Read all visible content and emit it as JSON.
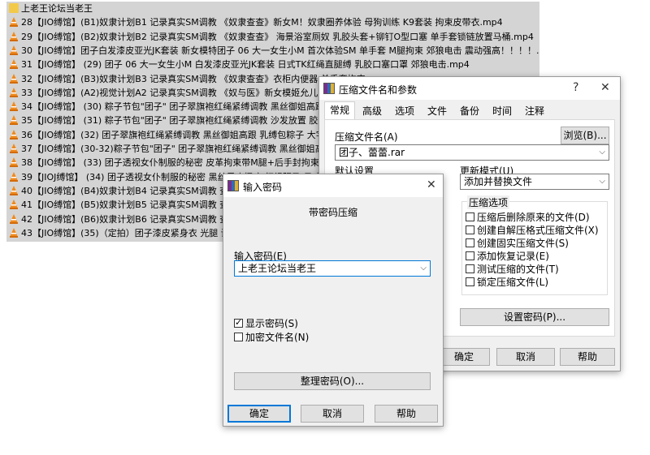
{
  "file_list": {
    "rows": [
      {
        "icon": "folder-icon",
        "name": "上老王论坛当老王"
      },
      {
        "icon": "vlc-cone-icon",
        "name": "28【JIO缚馆】(B1)奴隶计划B1 记录真实SM调教 《奴隶查查》新女M！奴隶圈养体验 母狗训练 K9套装 拘束皮带衣.mp4"
      },
      {
        "icon": "vlc-cone-icon",
        "name": "29【JIO缚馆】(B2)奴隶计划B2 记录真实SM调教 《奴隶查查》 海景浴室厕奴 乳胶头套+铆钉O型口塞 单手套锁链放置马桶.mp4"
      },
      {
        "icon": "vlc-cone-icon",
        "name": "30【JIO缚馆】团子白发漆皮亚光JK套装 新女模特团子 06 大一女生小M 首次体验SM 单手套 M腿拘束 郊狼电击 震动强高！！！！.MP4"
      },
      {
        "icon": "vlc-cone-icon",
        "name": "31【JIO缚馆】 (29) 团子 06 大一女生小M 白发漆皮亚光JK套装 日式TK红绳直腿缚 乳胶口塞口罩 郊狼电击.mp4"
      },
      {
        "icon": "vlc-cone-icon",
        "name": "32【JIO缚馆】(B3)奴隶计划B3 记录真实SM调教 《奴隶查查》衣柜内便器 单手套拘束"
      },
      {
        "icon": "vlc-cone-icon",
        "name": "33【JIO缚馆】(A2)视觉计划A2 记录真实SM调教 《奴与医》新女模姬允儿 红绳紧缚"
      },
      {
        "icon": "vlc-cone-icon",
        "name": "34【JIO缚馆】 (30) 粽子节包\"团子\" 团子翠旗袍红绳紧缚调教 黑丝御姐高跟 日式"
      },
      {
        "icon": "vlc-cone-icon",
        "name": "35【JIO缚馆】 (31) 粽子节包\"团子\" 团子翠旗袍红绳紧缚调教 沙发放置 胶绳+日式"
      },
      {
        "icon": "vlc-cone-icon",
        "name": "36【JIO缚馆】(32) 团子翠旗袍红绳紧缚调教 黑丝御姐高跟 乳缚包粽子 大字固定饭"
      },
      {
        "icon": "vlc-cone-icon",
        "name": "37【JIO缚馆】(30-32)粽子节包\"团子\" 团子翠旗袍红绳紧缚调教 黑丝御姐高跟 日式"
      },
      {
        "icon": "vlc-cone-icon",
        "name": "38【JIO缚馆】 (33) 团子透视女仆制服的秘密 皮革拘束带M腿+后手封拘束 双手拘"
      },
      {
        "icon": "vlc-cone-icon",
        "name": "39【JIOJ缚馆】 (34) 团子透视女仆制服的秘密 黑丝足底搔痒 红绳驷马 日式"
      },
      {
        "icon": "vlc-cone-icon",
        "name": "40【JIO缚馆】(B4)奴隶计划B4 记录真实SM调教 查查K9"
      },
      {
        "icon": "vlc-cone-icon",
        "name": "41【JIO缚馆】(B5)奴隶计划B5 记录真实SM调教 查查常"
      },
      {
        "icon": "vlc-cone-icon",
        "name": "42【JIO缚馆】(B6)奴隶计划B6 记录真实SM调教 查查首"
      },
      {
        "icon": "vlc-cone-icon",
        "name": "43【JIO缚馆】(35)（定拍）团子漆皮紧身衣 光腿 调教椅"
      }
    ]
  },
  "archive_dialog": {
    "title": "压缩文件名和参数",
    "help_glyph": "?",
    "close_glyph": "✕",
    "tabs": [
      "常规",
      "高级",
      "选项",
      "文件",
      "备份",
      "时间",
      "注释"
    ],
    "active_tab": 0,
    "archive_name_label": "压缩文件名(A)",
    "browse_label": "浏览(B)...",
    "archive_name_value": "团子、蕾蕾.rar",
    "default_settings_label": "默认设置",
    "update_mode_label": "更新模式(U)",
    "update_mode_value": "添加并替换文件",
    "options_group_title": "压缩选项",
    "options": [
      {
        "label": "压缩后删除原来的文件(D)",
        "checked": false
      },
      {
        "label": "创建自解压格式压缩文件(X)",
        "checked": false
      },
      {
        "label": "创建固实压缩文件(S)",
        "checked": false
      },
      {
        "label": "添加恢复记录(E)",
        "checked": false
      },
      {
        "label": "测试压缩的文件(T)",
        "checked": false
      },
      {
        "label": "锁定压缩文件(L)",
        "checked": false
      }
    ],
    "set_password_label": "设置密码(P)...",
    "ok_label": "确定",
    "cancel_label": "取消",
    "help_label": "帮助"
  },
  "password_dialog": {
    "title": "输入密码",
    "close_glyph": "✕",
    "heading": "带密码压缩",
    "password_label": "输入密码(E)",
    "password_value": "上老王论坛当老王",
    "show_password_label": "显示密码(S)",
    "show_password_checked": true,
    "encrypt_names_label": "加密文件名(N)",
    "encrypt_names_checked": false,
    "organize_label": "整理密码(O)...",
    "ok_label": "确定",
    "cancel_label": "取消",
    "help_label": "帮助"
  }
}
